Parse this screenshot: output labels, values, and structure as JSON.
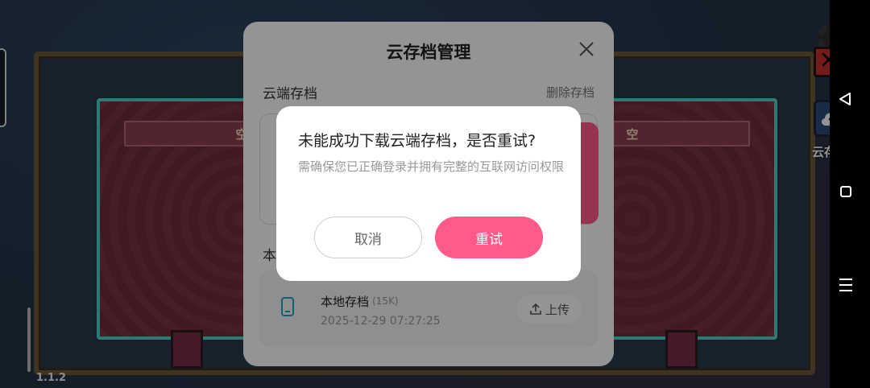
{
  "background": {
    "left_slot_label": "空",
    "right_slot_label": "空",
    "cloud_button_label": "云存档",
    "version": "1.1.2"
  },
  "cloud_dialog": {
    "title": "云存档管理",
    "cloud_section_label": "云端存档",
    "delete_label": "删除存档",
    "local_section_label": "本地存档",
    "local_save": {
      "name": "本地存档",
      "size": "(15K)",
      "date": "2025-12-29 07:27:25",
      "upload_label": "上传"
    }
  },
  "alert": {
    "title": "未能成功下载云端存档，是否重试?",
    "message": "需确保您已正确登录并拥有完整的互联网访问权限",
    "cancel_label": "取消",
    "retry_label": "重试"
  },
  "colors": {
    "accent_pink": "#ff5a8a",
    "slot_border": "#4dd0cc"
  },
  "icons": [
    "gear-icon",
    "close-x-icon",
    "cloud-upload-icon",
    "close-icon",
    "tablet-icon",
    "upload-icon",
    "nav-back-icon",
    "nav-home-icon",
    "nav-menu-icon"
  ]
}
